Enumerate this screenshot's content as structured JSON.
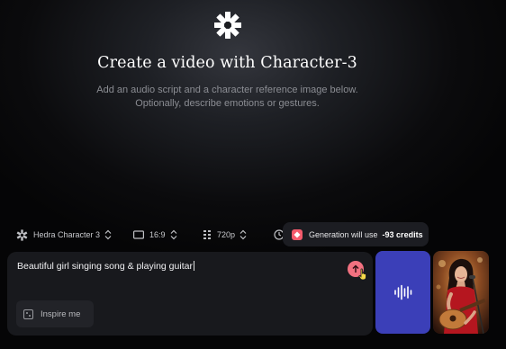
{
  "hero": {
    "logo_icon": "hedra-star-logo-icon",
    "title": "Create a video with Character-3",
    "subtitle_line1": "Add an audio script and a character reference image below.",
    "subtitle_line2": "Optionally, describe emotions or gestures."
  },
  "settings": {
    "model": {
      "icon": "hedra-logo-icon",
      "label": "Hedra Character 3"
    },
    "aspect_ratio": {
      "icon": "aspect-ratio-icon",
      "label": "16:9"
    },
    "resolution": {
      "icon": "resolution-icon",
      "label": "720p"
    },
    "duration": {
      "icon": "clock-icon"
    }
  },
  "credits": {
    "prefix": "Generation will use",
    "amount": "-93 credits",
    "accent": "#f45a6b"
  },
  "prompt": {
    "value": "Beautiful girl singing song & playing guitar",
    "inspire_label": "Inspire me",
    "send_color": "#f27180"
  },
  "audio": {
    "icon": "audio-waveform-icon",
    "color": "#3b3fb8"
  },
  "reference_image": {
    "subject": "woman singing with guitar on stage"
  }
}
